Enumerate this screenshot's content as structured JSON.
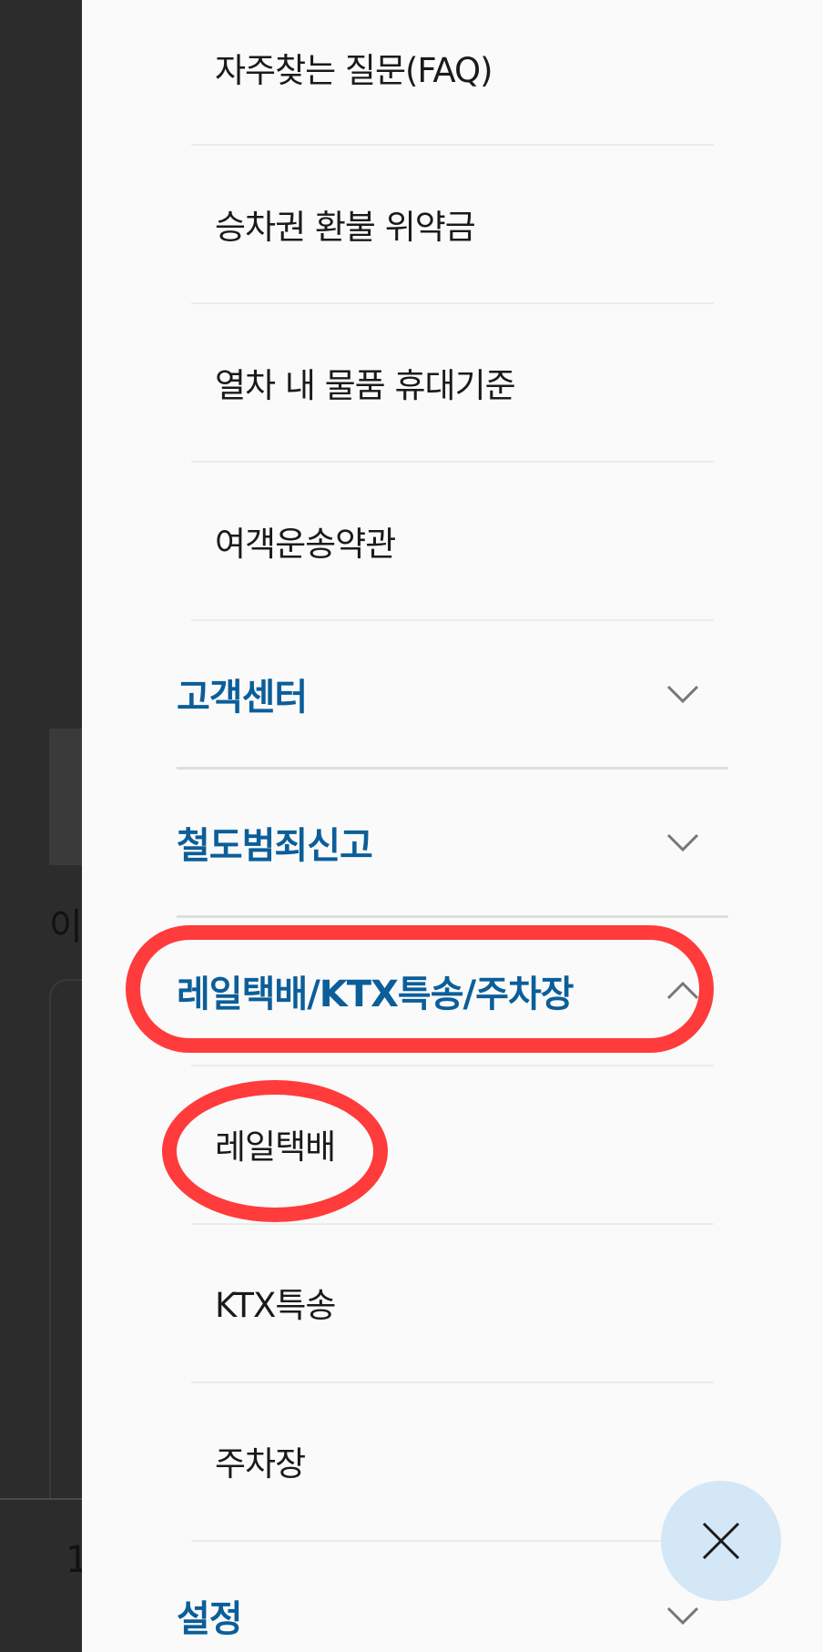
{
  "background": {
    "partial_text": "이",
    "partial_number": "1"
  },
  "menu": {
    "top_subitems": [
      {
        "label": "자주찾는 질문(FAQ)"
      },
      {
        "label": "승차권 환불 위약금"
      },
      {
        "label": "열차 내 물품 휴대기준"
      },
      {
        "label": "여객운송약관"
      }
    ],
    "categories": [
      {
        "label": "고객센터",
        "expanded": false
      },
      {
        "label": "철도범죄신고",
        "expanded": false
      },
      {
        "label": "레일택배/KTX특송/주차장",
        "expanded": true
      },
      {
        "label": "설정",
        "expanded": false
      }
    ],
    "expanded_subitems": [
      {
        "label": "레일택배"
      },
      {
        "label": "KTX특송"
      },
      {
        "label": "주차장"
      }
    ]
  },
  "close_button": {
    "icon": "close-icon"
  },
  "colors": {
    "category_text": "#0b5e99",
    "highlight": "#ff3b3b",
    "fab_background": "#d3e7f6"
  }
}
